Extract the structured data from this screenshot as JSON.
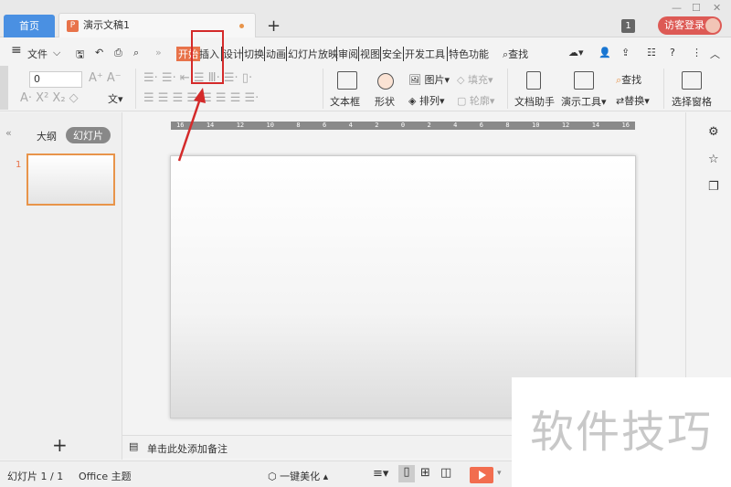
{
  "tabs": {
    "home": "首页",
    "doc": "演示文稿1",
    "new": "+"
  },
  "titlebar": {
    "badge": "1",
    "login": "访客登录"
  },
  "menu": {
    "hamburger": "≡",
    "file": "文件",
    "more": "»",
    "items": [
      "开始",
      "插入",
      "设计",
      "切换",
      "动画",
      "幻灯片放映",
      "审阅",
      "视图",
      "安全",
      "开发工具",
      "特色功能"
    ],
    "search": "查找"
  },
  "ribbon": {
    "font_size": "0",
    "textbox": "文本框",
    "shape": "形状",
    "picture": "图片",
    "fill": "填充",
    "arrange": "排列",
    "outline": "轮廓",
    "doc_helper": "文档助手",
    "present_tools": "演示工具",
    "find": "查找",
    "replace": "替换",
    "select_pane": "选择窗格"
  },
  "left_panel": {
    "outline_tab": "大纲",
    "slides_tab": "幻灯片",
    "slide_number": "1",
    "add": "+"
  },
  "ruler": [
    "16",
    "14",
    "12",
    "10",
    "8",
    "6",
    "4",
    "2",
    "0",
    "2",
    "4",
    "6",
    "8",
    "10",
    "12",
    "14",
    "16"
  ],
  "notes": {
    "placeholder": "单击此处添加备注"
  },
  "status": {
    "slide_count": "幻灯片 1 / 1",
    "theme": "Office 主题",
    "beautify": "一键美化"
  },
  "watermark": "软件技巧",
  "colors": {
    "accent": "#e8734a",
    "home_tab": "#4a90e2",
    "login": "#dd5a55",
    "annotation": "#d42a2a",
    "play": "#f26d4f"
  }
}
